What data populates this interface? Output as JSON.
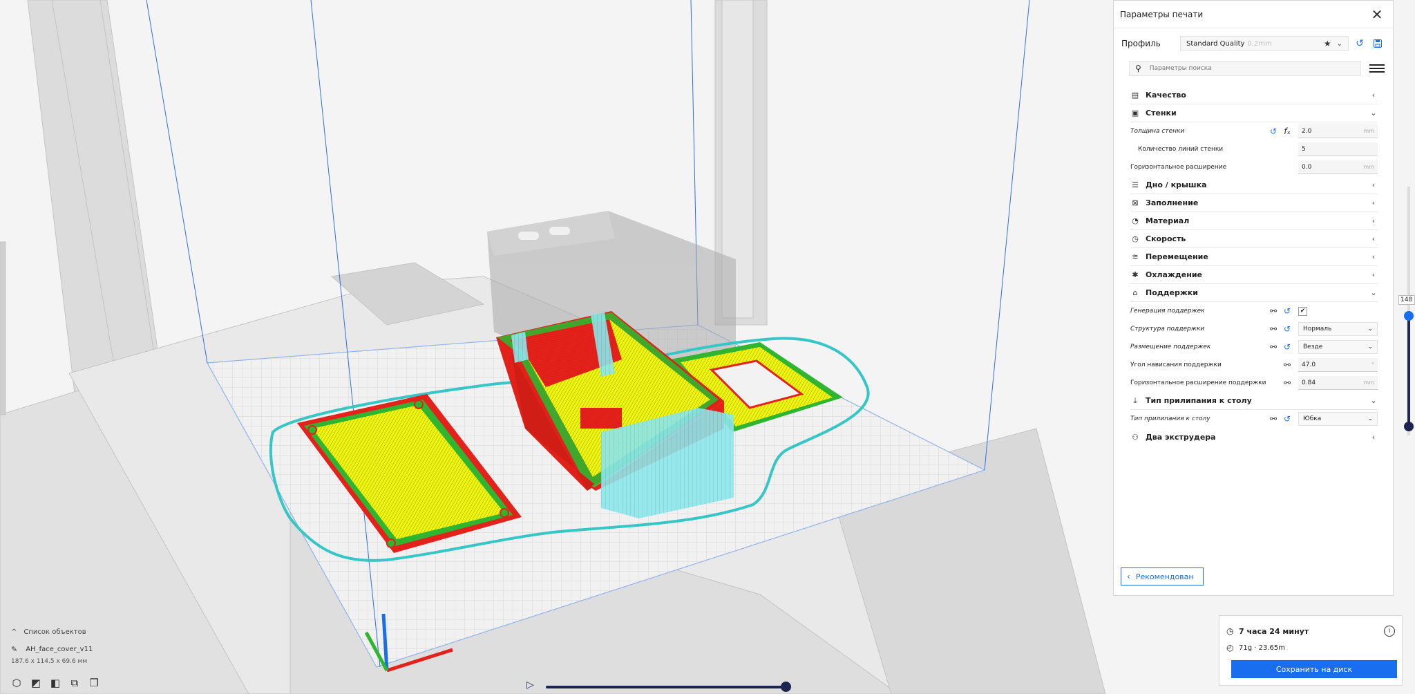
{
  "panel": {
    "title": "Параметры печати",
    "profile_label": "Профиль",
    "profile_value": "Standard Quality",
    "profile_sub": "0.2mm",
    "search_placeholder": "Параметры поиска",
    "recommended_label": "Рекомендован",
    "categories": {
      "quality": "Качество",
      "walls": "Стенки",
      "topbottom": "Дно / крышка",
      "infill": "Заполнение",
      "material": "Материал",
      "speed": "Скорость",
      "travel": "Перемещение",
      "cooling": "Охлаждение",
      "support": "Поддержки",
      "adhesion": "Тип прилипания к столу",
      "dual": "Два экструдера"
    },
    "walls": {
      "thickness_label": "Толщина стенки",
      "thickness_value": "2.0",
      "thickness_unit": "mm",
      "line_count_label": "Количество линий стенки",
      "line_count_value": "5",
      "horizontal_expansion_label": "Горизонтальное расширение",
      "horizontal_expansion_value": "0.0",
      "horizontal_expansion_unit": "mm"
    },
    "support": {
      "generate_label": "Генерация поддержек",
      "generate_checked": "✔",
      "structure_label": "Структура поддержки",
      "structure_value": "Нормаль",
      "placement_label": "Размещение поддержек",
      "placement_value": "Везде",
      "angle_label": "Угол нависания поддержки",
      "angle_value": "47.0",
      "angle_unit": "°",
      "hexp_label": "Горизонтальное расширение поддержки",
      "hexp_value": "0.84",
      "hexp_unit": "mm"
    },
    "adhesion": {
      "type_label": "Тип прилипания к столу",
      "type_value": "Юбка"
    }
  },
  "summary": {
    "time": "7 часа 24 минут",
    "material": "71g · 23.65m",
    "save_label": "Сохранить на диск"
  },
  "objects": {
    "header": "Список объектов",
    "item": "AH_face_cover_v11",
    "dimensions": "187.6 x 114.5 x 69.6 мм"
  },
  "layer": {
    "value": "148"
  },
  "colors": {
    "accent": "#196ef0",
    "wall": "#e8221a",
    "infill": "#f4f40a",
    "inner_wall": "#2db52d",
    "support": "#7fe3e8",
    "skirt": "#3bc8c8"
  },
  "icons": {
    "close": "close-icon",
    "star": "star-icon",
    "reset": "reset-icon",
    "save": "save-icon",
    "search": "search-icon",
    "menu": "menu-icon",
    "clock": "clock-icon",
    "weight": "weight-icon",
    "info": "info-icon",
    "link": "link-icon",
    "formula": "formula-icon",
    "play": "play-icon"
  }
}
